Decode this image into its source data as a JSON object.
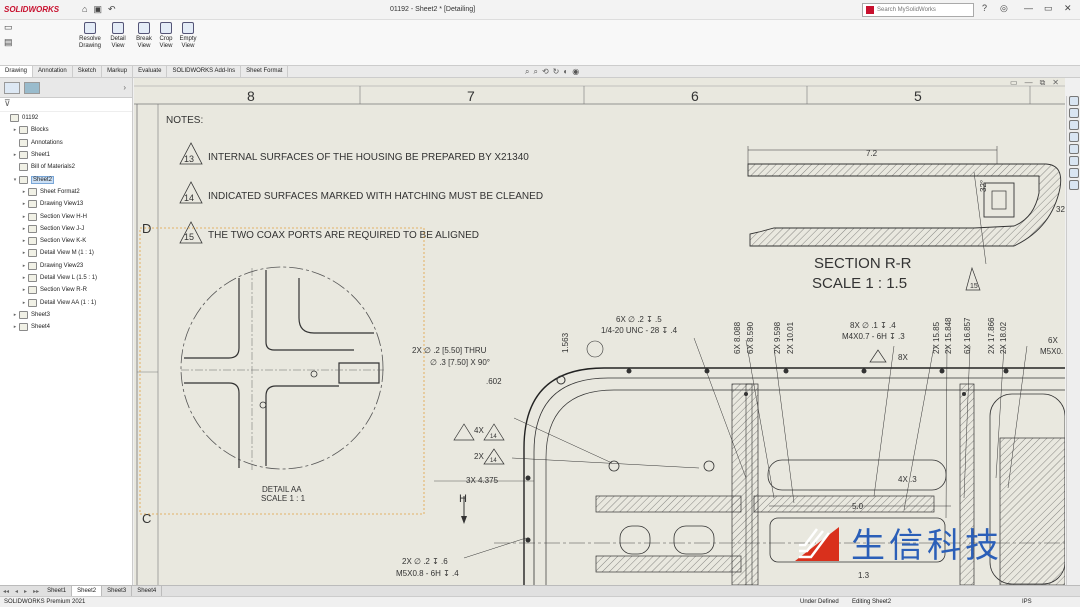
{
  "app": {
    "logo": "SOLIDWORKS",
    "doc_title": "01192 - Sheet2 * [Detailing]",
    "search_placeholder": "Search MySolidWorks"
  },
  "commands": [
    {
      "label": "Resolve\nDrawing",
      "icon": "resolve-drawing-icon"
    },
    {
      "label": "Detail\nView",
      "icon": "detail-view-icon"
    },
    {
      "label": "Break\nView",
      "icon": "break-view-icon"
    },
    {
      "label": "Crop\nView",
      "icon": "crop-view-icon"
    },
    {
      "label": "Empty\nView",
      "icon": "empty-view-icon"
    }
  ],
  "command_tabs": [
    "Drawing",
    "Annotation",
    "Sketch",
    "Markup",
    "Evaluate",
    "SOLIDWORKS Add-Ins",
    "Sheet Format"
  ],
  "active_command_tab": "Drawing",
  "tree": [
    {
      "label": "01192",
      "level": 0,
      "exp": ""
    },
    {
      "label": "Blocks",
      "level": 1,
      "exp": "▸"
    },
    {
      "label": "Annotations",
      "level": 1,
      "exp": ""
    },
    {
      "label": "Sheet1",
      "level": 1,
      "exp": "▸"
    },
    {
      "label": "Bill of Materials2",
      "level": 1,
      "exp": ""
    },
    {
      "label": "Sheet2",
      "level": 1,
      "exp": "▾",
      "selected": true
    },
    {
      "label": "Sheet Format2",
      "level": 2,
      "exp": "▸"
    },
    {
      "label": "Drawing View13",
      "level": 2,
      "exp": "▸"
    },
    {
      "label": "Section View H-H",
      "level": 2,
      "exp": "▸"
    },
    {
      "label": "Section View J-J",
      "level": 2,
      "exp": "▸"
    },
    {
      "label": "Section View K-K",
      "level": 2,
      "exp": "▸"
    },
    {
      "label": "Detail View M (1 : 1)",
      "level": 2,
      "exp": "▸"
    },
    {
      "label": "Drawing View23",
      "level": 2,
      "exp": "▸"
    },
    {
      "label": "Detail View L (1.5 : 1)",
      "level": 2,
      "exp": "▸"
    },
    {
      "label": "Section View R-R",
      "level": 2,
      "exp": "▸"
    },
    {
      "label": "Detail View AA (1 : 1)",
      "level": 2,
      "exp": "▸"
    },
    {
      "label": "Sheet3",
      "level": 1,
      "exp": "▸"
    },
    {
      "label": "Sheet4",
      "level": 1,
      "exp": "▸"
    }
  ],
  "drawing": {
    "zones_top": [
      "8",
      "7",
      "6",
      "5"
    ],
    "zones_side": [
      "D",
      "C"
    ],
    "notes_title": "NOTES:",
    "notes": [
      {
        "num": "13",
        "text": "INTERNAL SURFACES OF THE HOUSING BE PREPARED BY X21340"
      },
      {
        "num": "14",
        "text": "INDICATED SURFACES MARKED WITH  HATCHING MUST BE CLEANED"
      },
      {
        "num": "15",
        "text": "THE TWO COAX PORTS ARE REQUIRED TO BE ALIGNED"
      }
    ],
    "detail_label_1": "DETAIL AA",
    "detail_label_2": "SCALE 1 : 1",
    "section_label_1": "SECTION R-R",
    "section_label_2": "SCALE 1 : 1.5",
    "dims": {
      "d72": "7.2",
      "d32a": "32°",
      "d32b": "32",
      "flag15": "15",
      "thru1": "2X ∅ .2 [5.50] THRU",
      "thru2": "∅ .3 [7.50] X 90°",
      "d602": ".602",
      "d1563": "1.563",
      "unc1": "6X ∅ .2 ↧ .5",
      "unc2": "1/4-20 UNC - 28 ↧ .4",
      "v8088": "6X 8.088",
      "v8590": "6X 8.590",
      "v9598": "2X 9.598",
      "v1001": "2X 10.01",
      "m4a": "8X ∅ .1 ↧ .4",
      "m4b": "M4X0.7 - 6H ↧ .3",
      "x8": "8X",
      "v1585": "2X 15.85",
      "v15848": "2X 15.848",
      "v16857": "6X 16.857",
      "v17866": "2X 17.866",
      "v1802": "2X 18.02",
      "r6x": "6X",
      "r6x2": "M5X0.",
      "f4x": "4X",
      "f14": "14",
      "f2x": "2X",
      "d3x": "3X 4.375",
      "d4x3": "4X .3",
      "d50": "5.0",
      "d13": "1.3",
      "h": "H",
      "m5a": "2X ∅ .2 ↧ .6",
      "m5b": "M5X0.8 - 6H ↧ .4"
    }
  },
  "watermark": "生信科技",
  "sheet_tabs": [
    "Sheet1",
    "Sheet2",
    "Sheet3",
    "Sheet4"
  ],
  "active_sheet": "Sheet2",
  "status": {
    "product": "SOLIDWORKS Premium 2021",
    "state": "Under Defined",
    "editing": "Editing Sheet2",
    "units": "IPS"
  }
}
